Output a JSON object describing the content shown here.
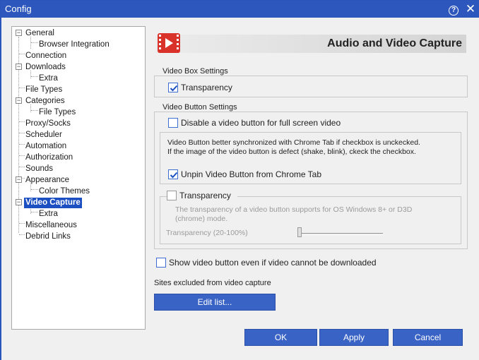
{
  "window": {
    "title": "Config"
  },
  "titlebar": {
    "help_glyph": "?",
    "close_glyph": "✕"
  },
  "tree": {
    "items": [
      {
        "label": "General"
      },
      {
        "label": "Browser Integration"
      },
      {
        "label": "Connection"
      },
      {
        "label": "Downloads"
      },
      {
        "label": "Extra"
      },
      {
        "label": "File Types"
      },
      {
        "label": "Categories"
      },
      {
        "label": "File Types"
      },
      {
        "label": "Proxy/Socks"
      },
      {
        "label": "Scheduler"
      },
      {
        "label": "Automation"
      },
      {
        "label": "Authorization"
      },
      {
        "label": "Sounds"
      },
      {
        "label": "Appearance"
      },
      {
        "label": "Color Themes"
      },
      {
        "label": "Video Capture"
      },
      {
        "label": "Extra"
      },
      {
        "label": "Miscellaneous"
      },
      {
        "label": "Debrid Links"
      }
    ],
    "selected": "Video Capture",
    "expander_glyph": "−"
  },
  "header": {
    "title": "Audio and Video Capture",
    "icon": "film-play-icon"
  },
  "video_box": {
    "legend": "Video Box Settings",
    "transparency": {
      "label": "Transparency",
      "checked": true
    }
  },
  "video_button": {
    "legend": "Video Button Settings",
    "disable_full_screen": {
      "label": "Disable a video button for full screen video",
      "checked": false
    },
    "info_line1": "Video Button better synchronized with Chrome Tab if checkbox is unckecked.",
    "info_line2": "If the image of the video button is defect (shake, blink), ckeck the checkbox.",
    "unpin": {
      "label": "Unpin Video Button from Chrome Tab",
      "checked": true
    },
    "transparency": {
      "label": "Transparency",
      "checked": false,
      "note_line1": "The transparency of a video button supports for OS Windows 8+ or D3D",
      "note_line2": "(chrome) mode.",
      "slider_label": "Transparency (20-100%)",
      "slider_value_percent": 20
    }
  },
  "show_button": {
    "label": "Show video button even if video cannot be downloaded",
    "checked": false
  },
  "excluded": {
    "label": "Sites excluded from video capture",
    "edit_button": "Edit list..."
  },
  "footer": {
    "ok": "OK",
    "apply": "Apply",
    "cancel": "Cancel"
  },
  "colors": {
    "accent": "#2d57bc",
    "button": "#3a63c6",
    "selection": "#1c4fc2",
    "icon_red": "#d9322a"
  }
}
